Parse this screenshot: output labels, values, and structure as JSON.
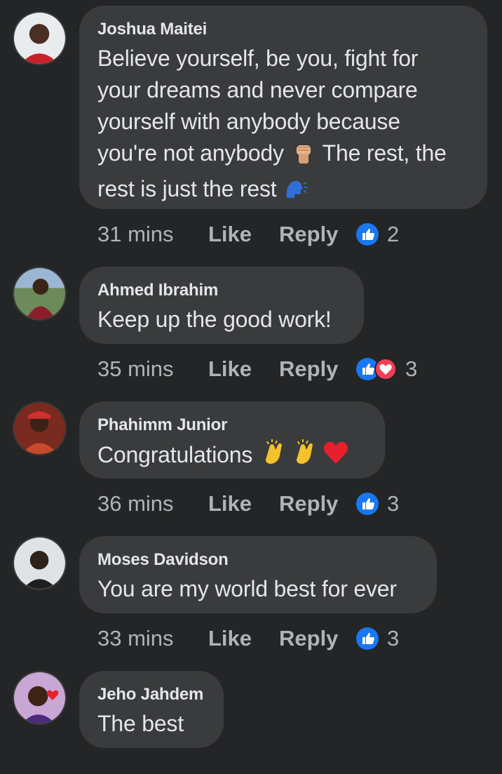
{
  "comments": [
    {
      "author": "Joshua Maitei",
      "lines": [
        "Believe yourself, be you, fight for",
        "your dreams and never compare",
        "yourself with anybody because",
        "you're not anybody",
        "The rest, the",
        "rest is just the rest"
      ],
      "time": "31 mins",
      "like_label": "Like",
      "reply_label": "Reply",
      "reaction_count": "2",
      "reactions": [
        "like"
      ]
    },
    {
      "author": "Ahmed Ibrahim",
      "text": "Keep up the good work!",
      "time": "35 mins",
      "like_label": "Like",
      "reply_label": "Reply",
      "reaction_count": "3",
      "reactions": [
        "like",
        "love"
      ]
    },
    {
      "author": "Phahimm Junior",
      "text": "Congratulations",
      "time": "36 mins",
      "like_label": "Like",
      "reply_label": "Reply",
      "reaction_count": "3",
      "reactions": [
        "like"
      ]
    },
    {
      "author": "Moses Davidson",
      "text": "You are my world best for ever",
      "time": "33 mins",
      "like_label": "Like",
      "reply_label": "Reply",
      "reaction_count": "3",
      "reactions": [
        "like"
      ]
    },
    {
      "author": "Jeho Jahdem",
      "text": "The best"
    }
  ],
  "icons": {
    "like": "like-reaction-icon",
    "love": "love-reaction-icon",
    "fist": "raised-fist-emoji",
    "speaking_head": "speaking-head-emoji",
    "clap": "clapping-hands-emoji",
    "heart": "red-heart-emoji"
  },
  "colors": {
    "background": "#242526",
    "bubble": "#3a3b3c",
    "primary_text": "#e4e6eb",
    "secondary_text": "#b0b3b8",
    "like_blue": "#1877f2",
    "love_red": "#f33e58"
  }
}
